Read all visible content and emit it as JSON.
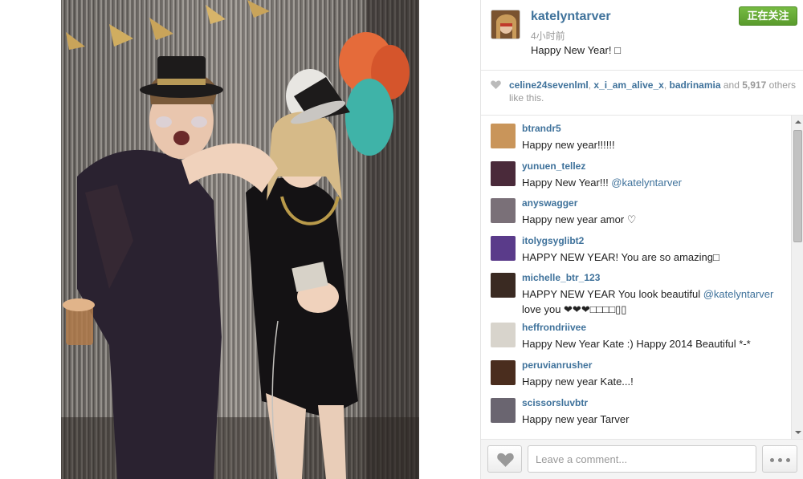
{
  "post": {
    "username": "katelyntarver",
    "time_ago": "4小时前",
    "caption": "Happy New Year! □",
    "follow_label": "正在关注"
  },
  "likes": {
    "users": [
      "celine24sevenlml",
      "x_i_am_alive_x",
      "badrinamia"
    ],
    "and_word": "and",
    "count": "5,917",
    "suffix": "others like this."
  },
  "comments": [
    {
      "user": "btrandr5",
      "text": "Happy new year!!!!!!",
      "avatar_color": "#c9955a"
    },
    {
      "user": "yunuen_tellez",
      "text": "Happy New Year!!! ",
      "mention": "@katelyntarver",
      "avatar_color": "#4a2a3a"
    },
    {
      "user": "anyswagger",
      "text": "Happy new year amor ♡",
      "avatar_color": "#7a7078"
    },
    {
      "user": "itolygsyglibt2",
      "text": "HAPPY NEW YEAR! You are so amazing□",
      "avatar_color": "#5a3b8a"
    },
    {
      "user": "michelle_btr_123",
      "text": "HAPPY NEW YEAR You look beautiful ",
      "mention": "@katelyntarver",
      "text2": " love you ❤❤❤□□□□▯▯",
      "avatar_color": "#3a2a22"
    },
    {
      "user": "heffrondriivee",
      "text": "Happy New Year Kate :) Happy 2014 Beautiful *-*",
      "avatar_color": "#d8d4cc"
    },
    {
      "user": "peruvianrusher",
      "text": "Happy new year Kate...!",
      "avatar_color": "#4a2d1e"
    },
    {
      "user": "scissorsluvbtr",
      "text": "Happy new year Tarver",
      "avatar_color": "#6a6570"
    }
  ],
  "footer": {
    "comment_placeholder": "Leave a comment..."
  },
  "colors": {
    "link": "#3f729b",
    "follow_green": "#6fad3c"
  }
}
